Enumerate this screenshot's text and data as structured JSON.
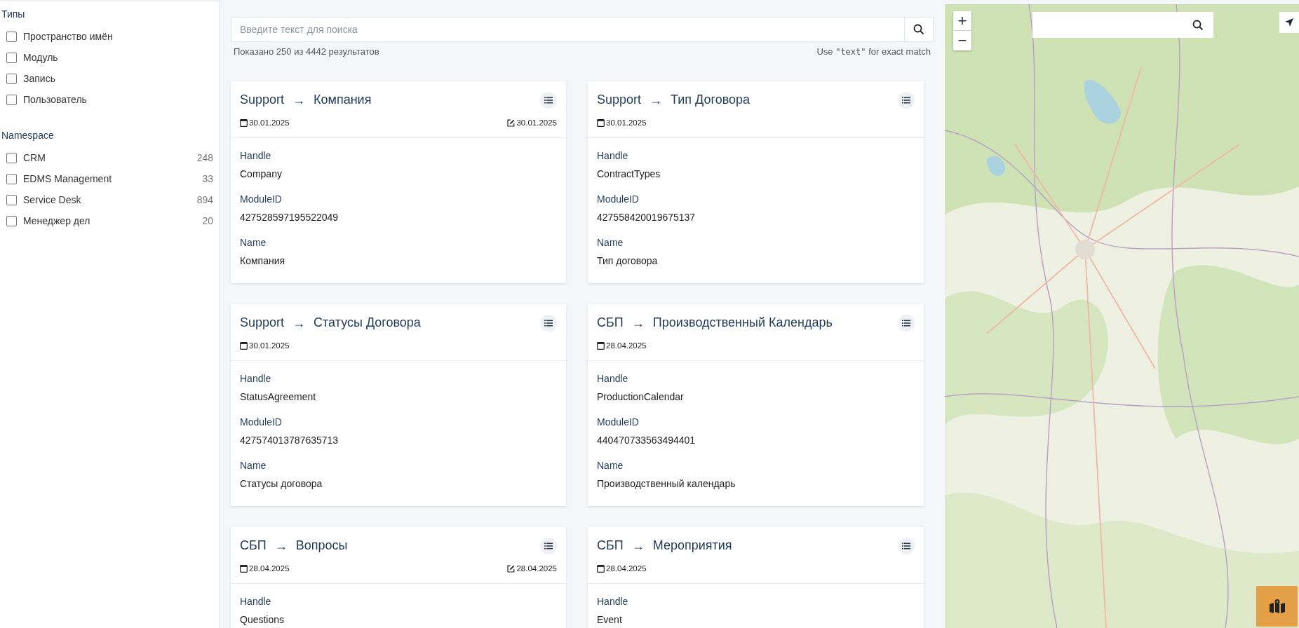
{
  "sidebar": {
    "sections": [
      {
        "title": "Типы",
        "items": [
          {
            "label": "Пространство имён",
            "checked": false
          },
          {
            "label": "Модуль",
            "checked": false
          },
          {
            "label": "Запись",
            "checked": false
          },
          {
            "label": "Пользователь",
            "checked": false
          }
        ]
      },
      {
        "title": "Namespace",
        "items": [
          {
            "label": "CRM",
            "count": "248",
            "checked": false
          },
          {
            "label": "EDMS Management",
            "count": "33",
            "checked": false
          },
          {
            "label": "Service Desk",
            "count": "894",
            "checked": false
          },
          {
            "label": "Менеджер дел",
            "count": "20",
            "checked": false
          }
        ]
      }
    ]
  },
  "search": {
    "placeholder": "Введите текст для поиска"
  },
  "results_text": "Показано 250 из 4442 результатов",
  "hint": {
    "before": "Use",
    "code": "\"text\"",
    "after": "for exact match"
  },
  "cards": [
    {
      "namespace": "Support",
      "arrow": "→",
      "title": "Компания",
      "created": "30.01.2025",
      "modified": "30.01.2025",
      "fields": [
        {
          "label": "Handle",
          "value": "Company"
        },
        {
          "label": "ModuleID",
          "value": "427528597195522049"
        },
        {
          "label": "Name",
          "value": "Компания"
        }
      ]
    },
    {
      "namespace": "Support",
      "arrow": "→",
      "title": "Тип Договора",
      "created": "30.01.2025",
      "fields": [
        {
          "label": "Handle",
          "value": "ContractTypes"
        },
        {
          "label": "ModuleID",
          "value": "427558420019675137"
        },
        {
          "label": "Name",
          "value": "Тип договора"
        }
      ]
    },
    {
      "namespace": "Support",
      "arrow": "→",
      "title": "Статусы Договора",
      "created": "30.01.2025",
      "fields": [
        {
          "label": "Handle",
          "value": "StatusAgreement"
        },
        {
          "label": "ModuleID",
          "value": "427574013787635713"
        },
        {
          "label": "Name",
          "value": "Статусы договора"
        }
      ]
    },
    {
      "namespace": "СБП",
      "arrow": "→",
      "title": "Производственный Календарь",
      "created": "28.04.2025",
      "fields": [
        {
          "label": "Handle",
          "value": "ProductionCalendar"
        },
        {
          "label": "ModuleID",
          "value": "440470733563494401"
        },
        {
          "label": "Name",
          "value": "Производственный календарь"
        }
      ]
    },
    {
      "namespace": "СБП",
      "arrow": "→",
      "title": "Вопросы",
      "created": "28.04.2025",
      "modified": "28.04.2025",
      "fields": [
        {
          "label": "Handle",
          "value": "Questions"
        }
      ]
    },
    {
      "namespace": "СБП",
      "arrow": "→",
      "title": "Мероприятия",
      "created": "28.04.2025",
      "fields": [
        {
          "label": "Handle",
          "value": "Event"
        }
      ]
    }
  ],
  "map": {
    "kind": "picture",
    "zoom_in": "+",
    "zoom_out": "−"
  }
}
